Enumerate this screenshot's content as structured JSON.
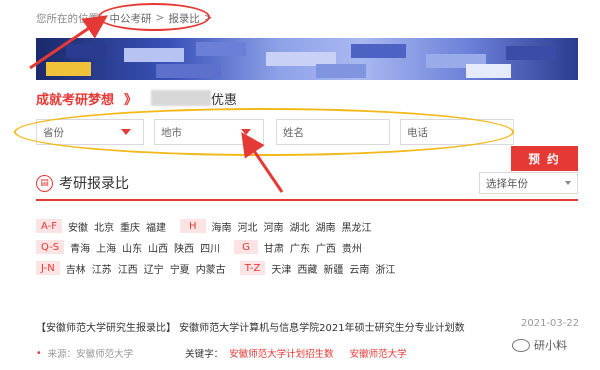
{
  "breadcrumb": {
    "prefix": "您所在的位置：",
    "items": [
      "中公考研",
      "报录比"
    ],
    "trailing": ">"
  },
  "promo": {
    "title": "成就考研梦想",
    "chevron": "》",
    "suffix": "优惠"
  },
  "form": {
    "province_placeholder": "省份",
    "city_placeholder": "地市",
    "name_placeholder": "姓名",
    "phone_placeholder": "电话",
    "submit_label": "预 约"
  },
  "section": {
    "title": "考研报录比",
    "year_select": "选择年份"
  },
  "provinces": [
    {
      "group1": "A-F",
      "list1": [
        "安徽",
        "北京",
        "重庆",
        "福建"
      ],
      "group2": "H",
      "list2": [
        "海南",
        "河北",
        "河南",
        "湖北",
        "湖南",
        "黑龙江"
      ]
    },
    {
      "group1": "Q-S",
      "list1": [
        "青海",
        "上海",
        "山东",
        "山西",
        "陕西",
        "四川"
      ],
      "group2": "G",
      "list2": [
        "甘肃",
        "广东",
        "广西",
        "贵州"
      ]
    },
    {
      "group1": "J-N",
      "list1": [
        "吉林",
        "江苏",
        "江西",
        "辽宁",
        "宁夏",
        "内蒙古"
      ],
      "group2": "T-Z",
      "list2": [
        "天津",
        "西藏",
        "新疆",
        "云南",
        "浙江"
      ]
    }
  ],
  "news": {
    "title": "【安徽师范大学研究生报录比】 安徽师范大学计算机与信息学院2021年硕士研究生分专业计划数",
    "date": "2021-03-22",
    "source": "来源：安徽师范大学",
    "keywords_label": "关键字：",
    "keywords": [
      "安徽师范大学计划招生数",
      "安徽师范大学"
    ]
  },
  "watermark": "研小料",
  "colors": {
    "accent": "#e53935",
    "annotation_yellow": "#f2b91a",
    "tag_bg": "#fde3e3"
  }
}
